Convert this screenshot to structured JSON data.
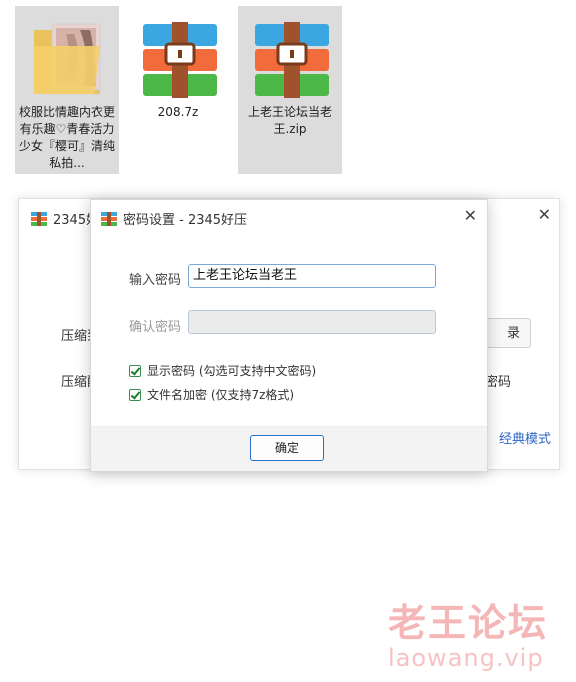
{
  "desktop": {
    "files": [
      {
        "name": "校服比情趣内衣更有乐趣♡青春活力少女『樱可』清纯私拍...",
        "icon": "folder-icon",
        "selected": true
      },
      {
        "name": "208.7z",
        "icon": "archive-icon",
        "selected": false
      },
      {
        "name": "上老王论坛当老王.zip",
        "icon": "archive-icon",
        "selected": true
      }
    ]
  },
  "back_window": {
    "title": "2345好",
    "row1_label": "压缩到",
    "row2_label": "压缩配",
    "browse_fragment": "录",
    "right_fragment": "密码",
    "mode_link": "经典模式"
  },
  "dialog": {
    "title": "密码设置 - 2345好压",
    "password_label": "输入密码",
    "password_value": "上老王论坛当老王",
    "confirm_label": "确认密码",
    "confirm_value": "",
    "show_password_label": "显示密码 (勾选可支持中文密码)",
    "show_password_checked": true,
    "encrypt_names_label": "文件名加密  (仅支持7z格式)",
    "encrypt_names_checked": true,
    "ok_label": "确定"
  },
  "watermark": {
    "title": "老王论坛",
    "url": "laowang.vip"
  },
  "colors": {
    "link": "#2b66c9",
    "checkbox_green": "#3a8f4a",
    "button_border": "#2b6fd1",
    "watermark": "#f4b6b6"
  }
}
